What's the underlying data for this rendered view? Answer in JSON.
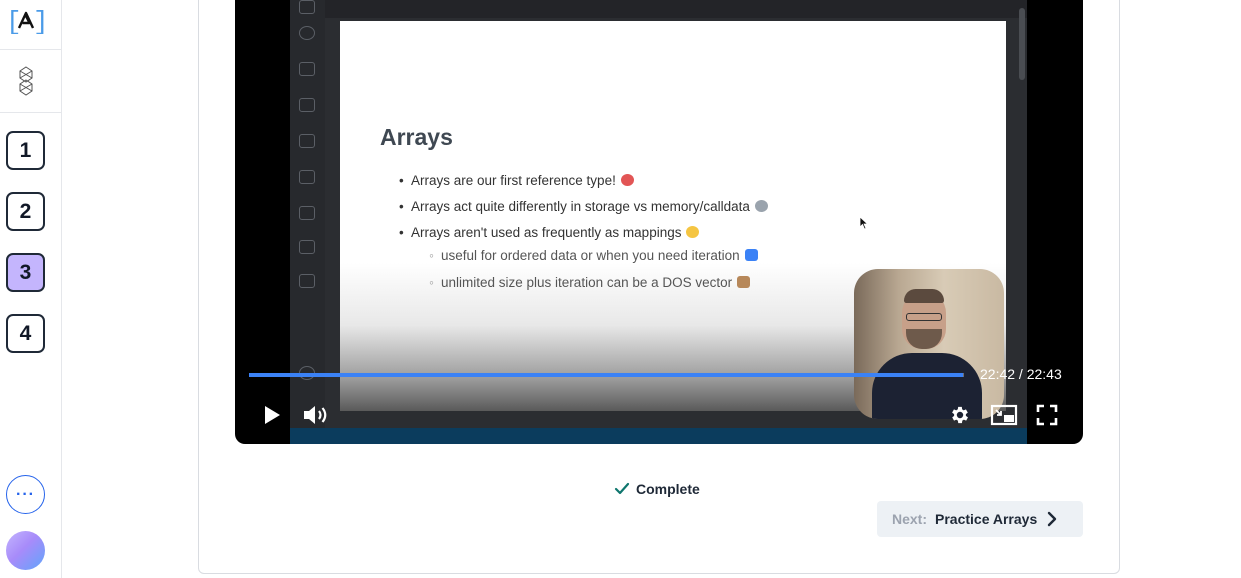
{
  "sidebar": {
    "steps": [
      "1",
      "2",
      "3",
      "4"
    ],
    "active_step": "3",
    "more_label": "···"
  },
  "video": {
    "slide": {
      "title": "Arrays",
      "bullets": [
        "Arrays are our first reference type!",
        "Arrays act quite differently in storage vs memory/calldata",
        "Arrays aren't used as frequently as mappings"
      ],
      "sub_bullets": [
        "useful for ordered data or when you need iteration",
        "unlimited size plus iteration can be a DOS vector"
      ]
    },
    "time_current": "22:42",
    "time_total": "22:43",
    "time_separator": " / ",
    "progress": 0.999,
    "accent_color": "#3b82f6",
    "icons": [
      "play-icon",
      "volume-icon",
      "settings-icon",
      "picture-in-picture-icon",
      "fullscreen-icon"
    ]
  },
  "complete_label": "Complete",
  "next": {
    "prefix": "Next:",
    "title": "Practice Arrays"
  },
  "colors": {
    "active_step_bg": "#c4b5fd",
    "more_button": "#2563eb",
    "complete_check": "#0f766e"
  }
}
